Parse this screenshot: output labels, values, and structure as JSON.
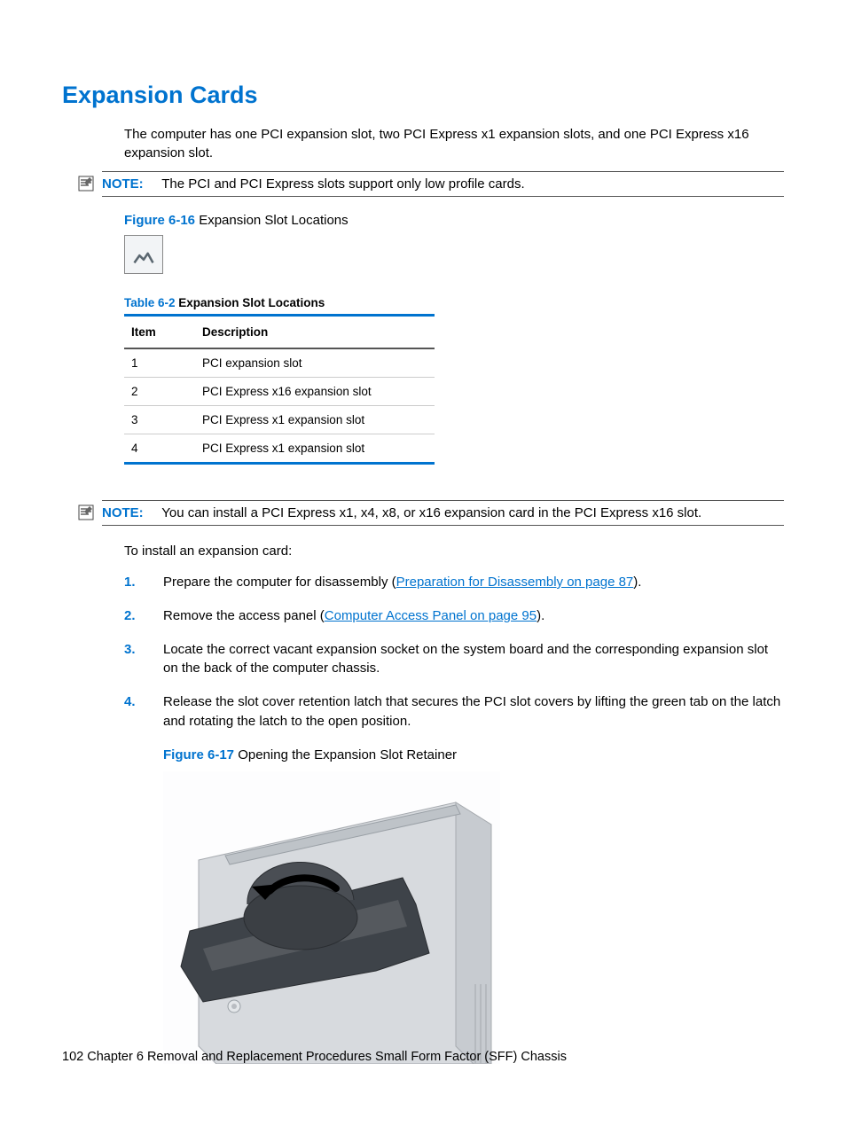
{
  "title": "Expansion Cards",
  "intro": "The computer has one PCI expansion slot, two PCI Express x1 expansion slots, and one PCI Express x16 expansion slot.",
  "note1": {
    "label": "NOTE:",
    "text": "The PCI and PCI Express slots support only low profile cards."
  },
  "figure1": {
    "label": "Figure 6-16",
    "title": "  Expansion Slot Locations"
  },
  "table": {
    "label": "Table 6-2",
    "title": "  Expansion Slot Locations",
    "head_item": "Item",
    "head_desc": "Description",
    "rows": [
      {
        "item": "1",
        "desc": "PCI expansion slot"
      },
      {
        "item": "2",
        "desc": "PCI Express x16 expansion slot"
      },
      {
        "item": "3",
        "desc": "PCI Express x1 expansion slot"
      },
      {
        "item": "4",
        "desc": "PCI Express x1 expansion slot"
      }
    ]
  },
  "note2": {
    "label": "NOTE:",
    "text": "You can install a PCI Express x1, x4, x8, or x16 expansion card in the PCI Express x16 slot."
  },
  "instr_lead": "To install an expansion card:",
  "steps": {
    "1": {
      "num": "1.",
      "pre": "Prepare the computer for disassembly (",
      "link": "Preparation for Disassembly on page 87",
      "post": ")."
    },
    "2": {
      "num": "2.",
      "pre": "Remove the access panel (",
      "link": "Computer Access Panel on page 95",
      "post": ")."
    },
    "3": {
      "num": "3.",
      "text": "Locate the correct vacant expansion socket on the system board and the corresponding expansion slot on the back of the computer chassis."
    },
    "4": {
      "num": "4.",
      "text": "Release the slot cover retention latch that secures the PCI slot covers by lifting the green tab on the latch and rotating the latch to the open position."
    }
  },
  "figure2": {
    "label": "Figure 6-17",
    "title": "  Opening the Expansion Slot Retainer"
  },
  "footer": {
    "pagenum": "102",
    "chapter": "   Chapter 6   Removal and Replacement Procedures Small Form Factor (SFF) Chassis"
  }
}
